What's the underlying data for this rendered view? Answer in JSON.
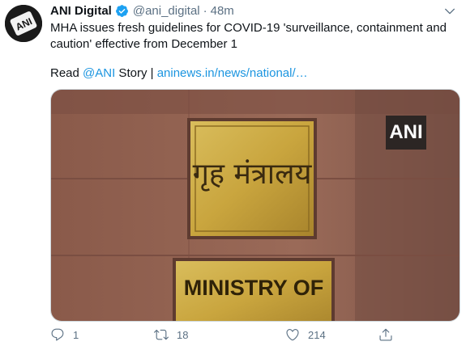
{
  "tweet": {
    "author_name": "ANI Digital",
    "handle": "@ani_digital",
    "separator": "·",
    "time": "48m",
    "text": "MHA issues fresh guidelines for COVID-19 'surveillance, containment and caution' effective from December 1",
    "read_prefix": "Read ",
    "read_mention": "@ANI",
    "read_middle": " Story | ",
    "read_link": "aninews.in/news/national/…"
  },
  "media": {
    "watermark": "ANI",
    "hindi_sign": "गृह मंत्रालय",
    "english_sign": "MINISTRY OF"
  },
  "actions": {
    "reply_count": "1",
    "retweet_count": "18",
    "like_count": "214"
  },
  "colors": {
    "accent": "#1b95e0",
    "muted": "#5b7083",
    "sign_brass": "#c9a53e"
  },
  "icons": [
    "avatar-ani-logo",
    "verified-badge-icon",
    "chevron-down-icon",
    "reply-icon",
    "retweet-icon",
    "like-icon",
    "share-icon"
  ]
}
